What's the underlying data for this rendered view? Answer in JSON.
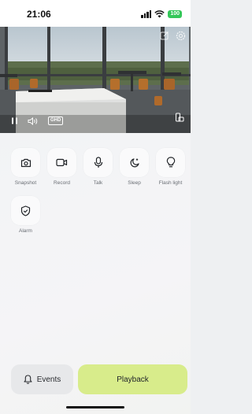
{
  "status_bar": {
    "time": "21:06",
    "battery": "100"
  },
  "video": {
    "quality_badge": "GHD",
    "icons": [
      "edit-icon",
      "settings-icon",
      "pause-icon",
      "volume-icon",
      "quality-icon",
      "fullscreen-icon"
    ]
  },
  "controls": {
    "rows": [
      [
        {
          "label": "Snapshot",
          "icon": "camera-icon"
        },
        {
          "label": "Record",
          "icon": "video-record-icon"
        },
        {
          "label": "Talk",
          "icon": "microphone-icon"
        },
        {
          "label": "Sleep",
          "icon": "moon-icon"
        },
        {
          "label": "Flash light",
          "icon": "lightbulb-icon"
        }
      ],
      [
        {
          "label": "Alarm",
          "icon": "shield-alarm-icon"
        }
      ]
    ]
  },
  "bottom": {
    "events_label": "Events",
    "playback_label": "Playback"
  },
  "colors": {
    "accent": "#d8ec8b",
    "battery": "#34c759"
  }
}
